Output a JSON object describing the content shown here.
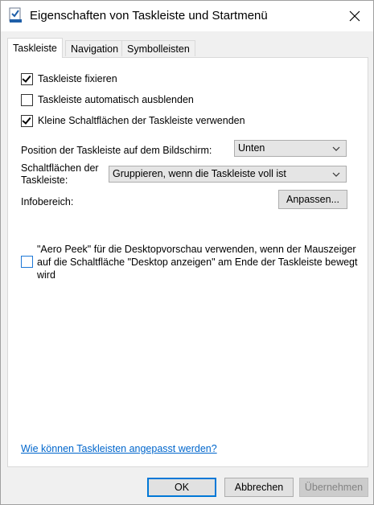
{
  "window": {
    "title": "Eigenschaften von Taskleiste und Startmenü"
  },
  "tabs": [
    {
      "label": "Taskleiste",
      "active": true
    },
    {
      "label": "Navigation",
      "active": false
    },
    {
      "label": "Symbolleisten",
      "active": false
    }
  ],
  "options": [
    {
      "label": "Taskleiste fixieren",
      "checked": true
    },
    {
      "label": "Taskleiste automatisch ausblenden",
      "checked": false
    },
    {
      "label": "Kleine Schaltflächen der Taskleiste verwenden",
      "checked": true
    }
  ],
  "position": {
    "label": "Position der Taskleiste auf dem Bildschirm:",
    "value": "Unten"
  },
  "buttons_group": {
    "label": "Schaltflächen der Taskleiste:",
    "value": "Gruppieren, wenn die Taskleiste voll ist"
  },
  "infobereich": {
    "label": "Infobereich:",
    "button": "Anpassen..."
  },
  "aero_peek": {
    "label": "\"Aero Peek\" für die Desktopvorschau verwenden, wenn der Mauszeiger auf die Schaltfläche \"Desktop anzeigen\" am Ende der Taskleiste bewegt wird",
    "checked": false
  },
  "help_link": "Wie können Taskleisten angepasst werden?",
  "footer": {
    "ok": "OK",
    "cancel": "Abbrechen",
    "apply": "Übernehmen"
  },
  "icons": {
    "app": "taskbar-properties-icon",
    "close": "close-icon",
    "dropdown": "chevron-down-icon"
  }
}
